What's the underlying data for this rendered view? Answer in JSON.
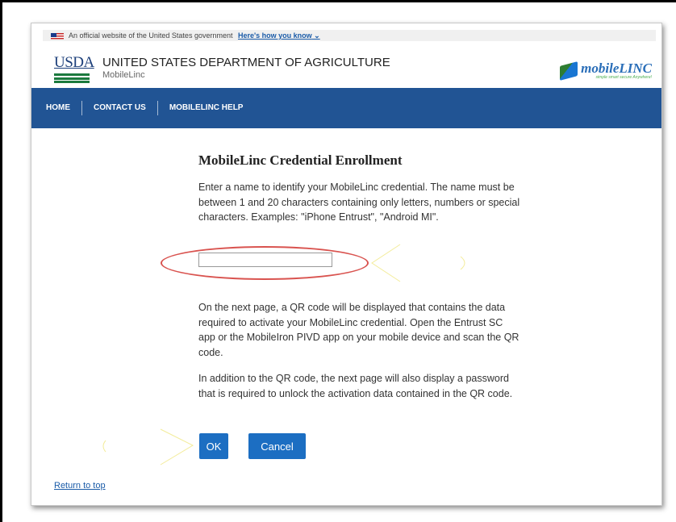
{
  "gov_banner": {
    "text": "An official website of the United States government",
    "link": "Here's how you know"
  },
  "header": {
    "logo": "USDA",
    "agency": "UNITED STATES DEPARTMENT OF AGRICULTURE",
    "sub": "MobileLinc",
    "brand_main": "mobileLINC",
    "brand_tag": "simple smart secure Anywhere!"
  },
  "nav": {
    "items": [
      "HOME",
      "CONTACT US",
      "MOBILELINC HELP"
    ]
  },
  "main": {
    "title": "MobileLinc Credential Enrollment",
    "intro": "Enter a name to identify your MobileLinc credential. The name must be between 1 and 20 characters containing only letters, numbers or special characters. Examples: \"iPhone Entrust\", \"Android MI\".",
    "input_value": "",
    "para2": "On the next page, a QR code will be displayed that contains the data required to activate your MobileLinc credential. Open the Entrust SC app or the MobileIron PIVD app on your mobile device and scan the QR code.",
    "para3": "In addition to the QR code, the next page will also display a password that is required to unlock the activation data contained in the QR code.",
    "ok_label": "OK",
    "cancel_label": "Cancel",
    "return_link": "Return to top"
  },
  "colors": {
    "nav_bg": "#215494",
    "button_bg": "#1c6ec2",
    "highlight": "#d9534f"
  }
}
